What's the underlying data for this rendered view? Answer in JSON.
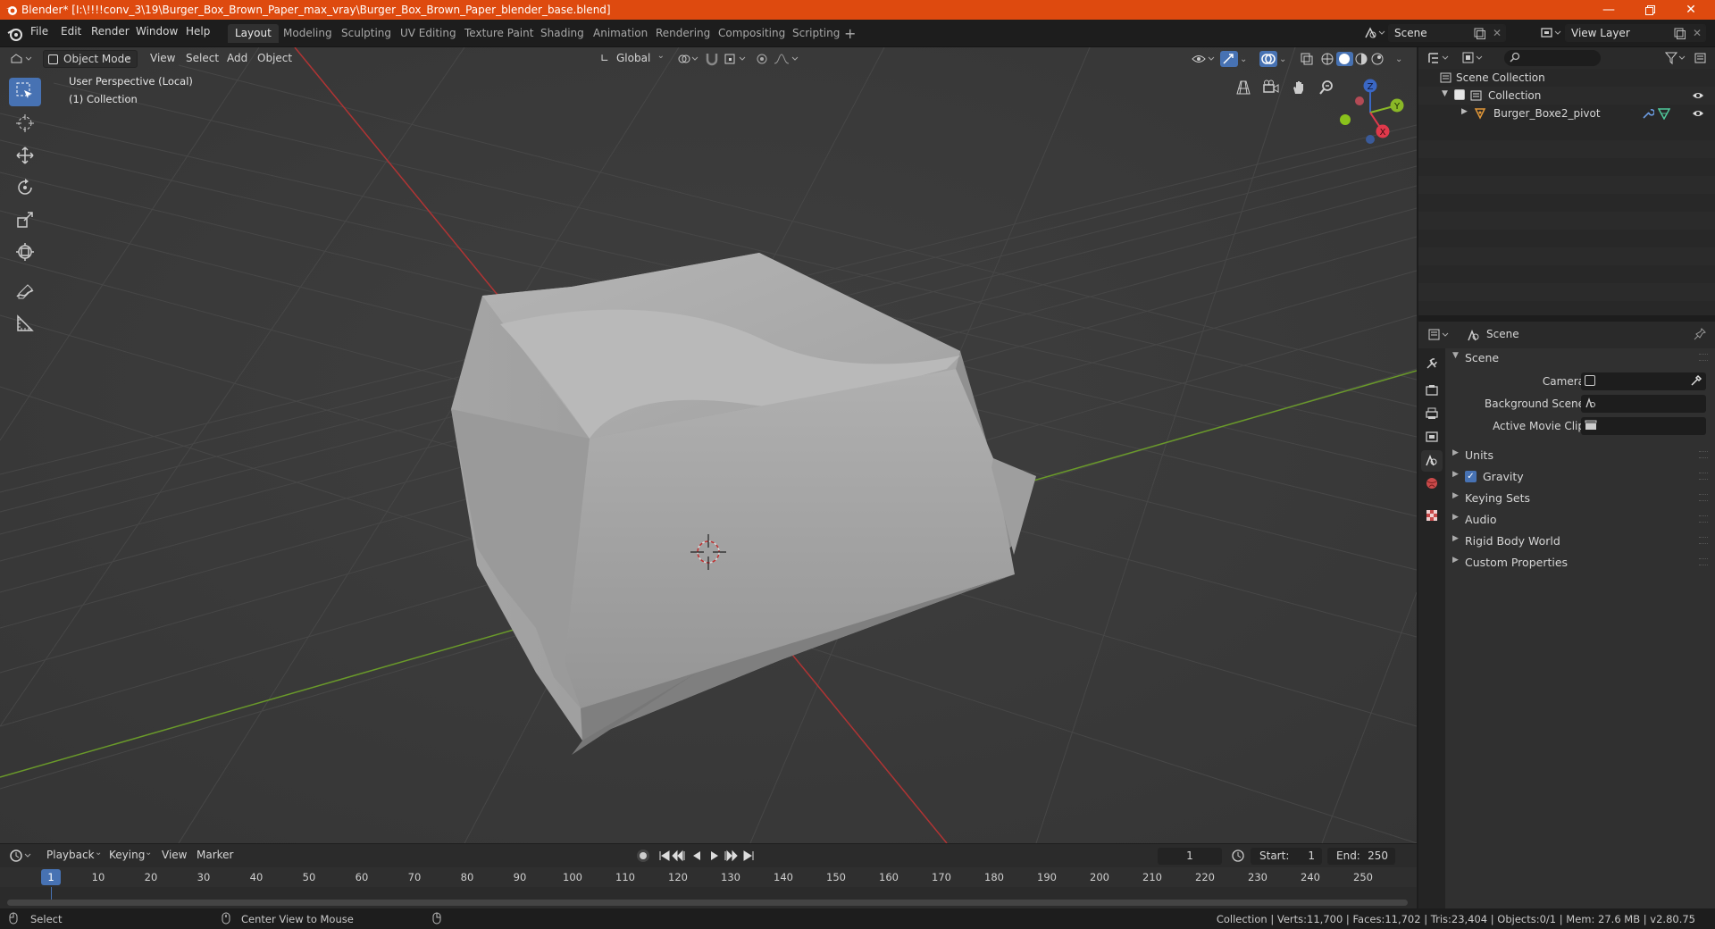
{
  "window": {
    "title": "Blender* [I:\\!!!!conv_3\\19\\Burger_Box_Brown_Paper_max_vray\\Burger_Box_Brown_Paper_blender_base.blend]",
    "controls": [
      "minimize-icon",
      "restore-icon",
      "close-icon"
    ]
  },
  "menubar": {
    "items": [
      "File",
      "Edit",
      "Render",
      "Window",
      "Help"
    ]
  },
  "workspaces": {
    "tabs": [
      "Layout",
      "Modeling",
      "Sculpting",
      "UV Editing",
      "Texture Paint",
      "Shading",
      "Animation",
      "Rendering",
      "Compositing",
      "Scripting"
    ],
    "active": "Layout",
    "add_icon": "plus-icon"
  },
  "scene_selector": {
    "value": "Scene"
  },
  "view_layer_selector": {
    "value": "View Layer"
  },
  "viewport": {
    "mode": "Object Mode",
    "menus": [
      "View",
      "Select",
      "Add",
      "Object"
    ],
    "transform_orientation": "Global",
    "overlay_text": {
      "line1": "User Perspective (Local)",
      "line2": "(1) Collection"
    },
    "gizmo_axes": [
      "Z",
      "Y",
      "X"
    ],
    "tools": [
      "select-box-icon",
      "cursor-icon",
      "move-icon",
      "rotate-icon",
      "scale-icon",
      "transform-icon",
      "annotate-icon",
      "measure-icon"
    ],
    "active_tool": "select-box-icon",
    "colors": {
      "background": "#3a3a3a",
      "grid": "#444444",
      "x_axis": "#b03434",
      "y_axis": "#6a9a2a",
      "object": "#a8a8a8"
    }
  },
  "outliner": {
    "root": "Scene Collection",
    "collection": "Collection",
    "object": "Burger_Boxe2_pivot"
  },
  "properties": {
    "context_label": "Scene",
    "section_title": "Scene",
    "fields": [
      {
        "label": "Camera"
      },
      {
        "label": "Background Scene"
      },
      {
        "label": "Active Movie Clip"
      }
    ],
    "panels": [
      "Units",
      "Gravity",
      "Keying Sets",
      "Audio",
      "Rigid Body World",
      "Custom Properties"
    ],
    "gravity_checked": true
  },
  "timeline": {
    "menus": [
      "Playback",
      "Keying",
      "View",
      "Marker"
    ],
    "current_frame": "1",
    "start_label": "Start:",
    "start": "1",
    "end_label": "End:",
    "end": "250",
    "ruler": [
      "1",
      "10",
      "20",
      "30",
      "40",
      "50",
      "60",
      "70",
      "80",
      "90",
      "100",
      "110",
      "120",
      "130",
      "140",
      "150",
      "160",
      "170",
      "180",
      "190",
      "200",
      "210",
      "220",
      "230",
      "240",
      "250"
    ]
  },
  "statusbar": {
    "left_action": "Select",
    "middle_action": "Center View to Mouse",
    "stats": "Collection | Verts:11,700 | Faces:11,702 | Tris:23,404 | Objects:0/1 | Mem: 27.6 MB | v2.80.75"
  }
}
